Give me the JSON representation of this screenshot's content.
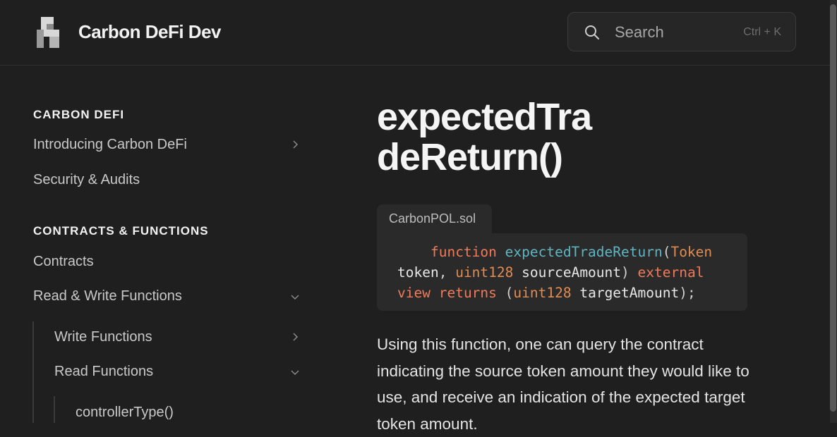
{
  "header": {
    "site_title": "Carbon DeFi Dev",
    "search_placeholder": "Search",
    "search_shortcut": "Ctrl + K"
  },
  "sidebar": {
    "sections": [
      {
        "title": "CARBON DEFI",
        "items": [
          {
            "label": "Introducing Carbon DeFi",
            "chevron": "right"
          },
          {
            "label": "Security & Audits"
          }
        ]
      },
      {
        "title": "CONTRACTS & FUNCTIONS",
        "items": [
          {
            "label": "Contracts"
          },
          {
            "label": "Read & Write Functions",
            "chevron": "down"
          },
          {
            "label": "Write Functions",
            "chevron": "right"
          },
          {
            "label": "Read Functions",
            "chevron": "down"
          },
          {
            "label": "controllerType()"
          }
        ]
      }
    ]
  },
  "main": {
    "page_title": "expectedTradeReturn()",
    "file_tab": "CarbonPOL.sol",
    "code_tokens": {
      "kw_function": "function",
      "fn_name": "expectedTradeReturn",
      "paren_open": "(",
      "type_token": "Token",
      "var_token": "token",
      "comma": ",",
      "type_uint128_a": "uint128",
      "var_source": "sourceAmount",
      "paren_close": ")",
      "kw_external": "external",
      "kw_view": "view",
      "kw_returns": "returns",
      "paren_open2": "(",
      "type_uint128_b": "uint128",
      "var_target": "targetAmount",
      "end": ");"
    },
    "paragraph": "Using this function, one can query the contract indicating the source token amount they would like to use, and receive an indication of the expected target token amount."
  },
  "colors": {
    "background": "#1f1f1f",
    "code_keyword": "#f07b5b",
    "code_function": "#5fb6c2",
    "code_type": "#e08c52"
  }
}
